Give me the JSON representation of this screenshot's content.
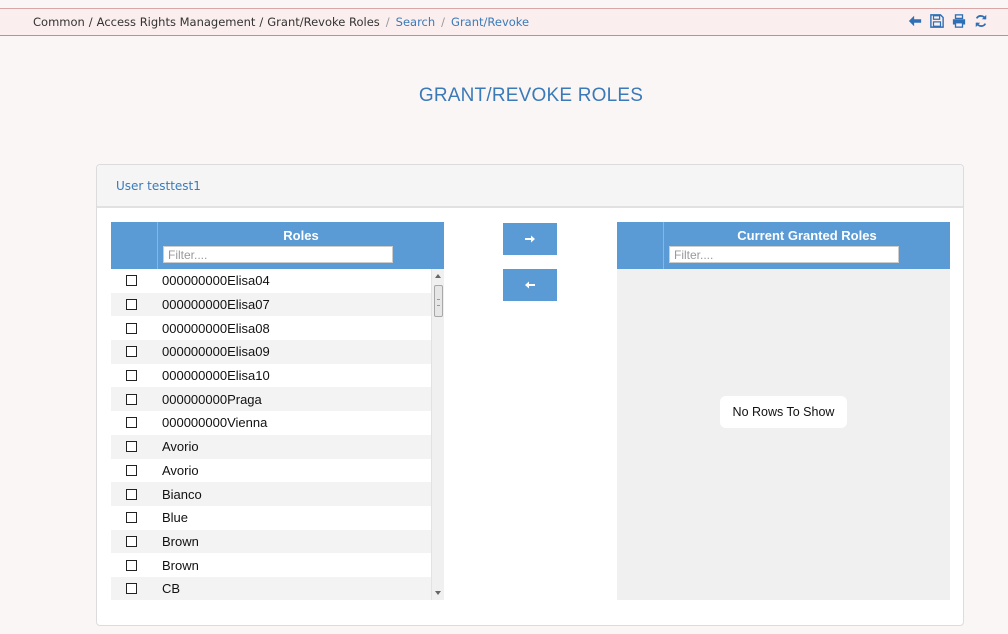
{
  "breadcrumb": {
    "root": "Common",
    "section": "Access Rights Management",
    "page": "Grant/Revoke Roles",
    "link_search": "Search",
    "link_current": "Grant/Revoke",
    "separator": "/"
  },
  "toolbar": {
    "icons": [
      "back-arrow-icon",
      "save-icon",
      "print-icon",
      "refresh-icon"
    ],
    "accent_color": "#2e6fb5"
  },
  "page_title": "GRANT/REVOKE ROLES",
  "panel": {
    "header": "User testtest1"
  },
  "roles_grid": {
    "title": "Roles",
    "filter_placeholder": "Filter....",
    "rows": [
      "000000000Elisa04",
      "000000000Elisa07",
      "000000000Elisa08",
      "000000000Elisa09",
      "000000000Elisa10",
      "000000000Praga",
      "000000000Vienna",
      "Avorio",
      "Avorio",
      "Bianco",
      "Blue",
      "Brown",
      "Brown",
      "CB"
    ]
  },
  "move_buttons": {
    "grant_icon": "arrow-right-icon",
    "revoke_icon": "arrow-left-icon"
  },
  "granted_grid": {
    "title": "Current Granted Roles",
    "filter_placeholder": "Filter....",
    "empty_message": "No Rows To Show"
  },
  "colors": {
    "header_blue": "#5b9bd5",
    "link_blue": "#3a7ab8"
  }
}
